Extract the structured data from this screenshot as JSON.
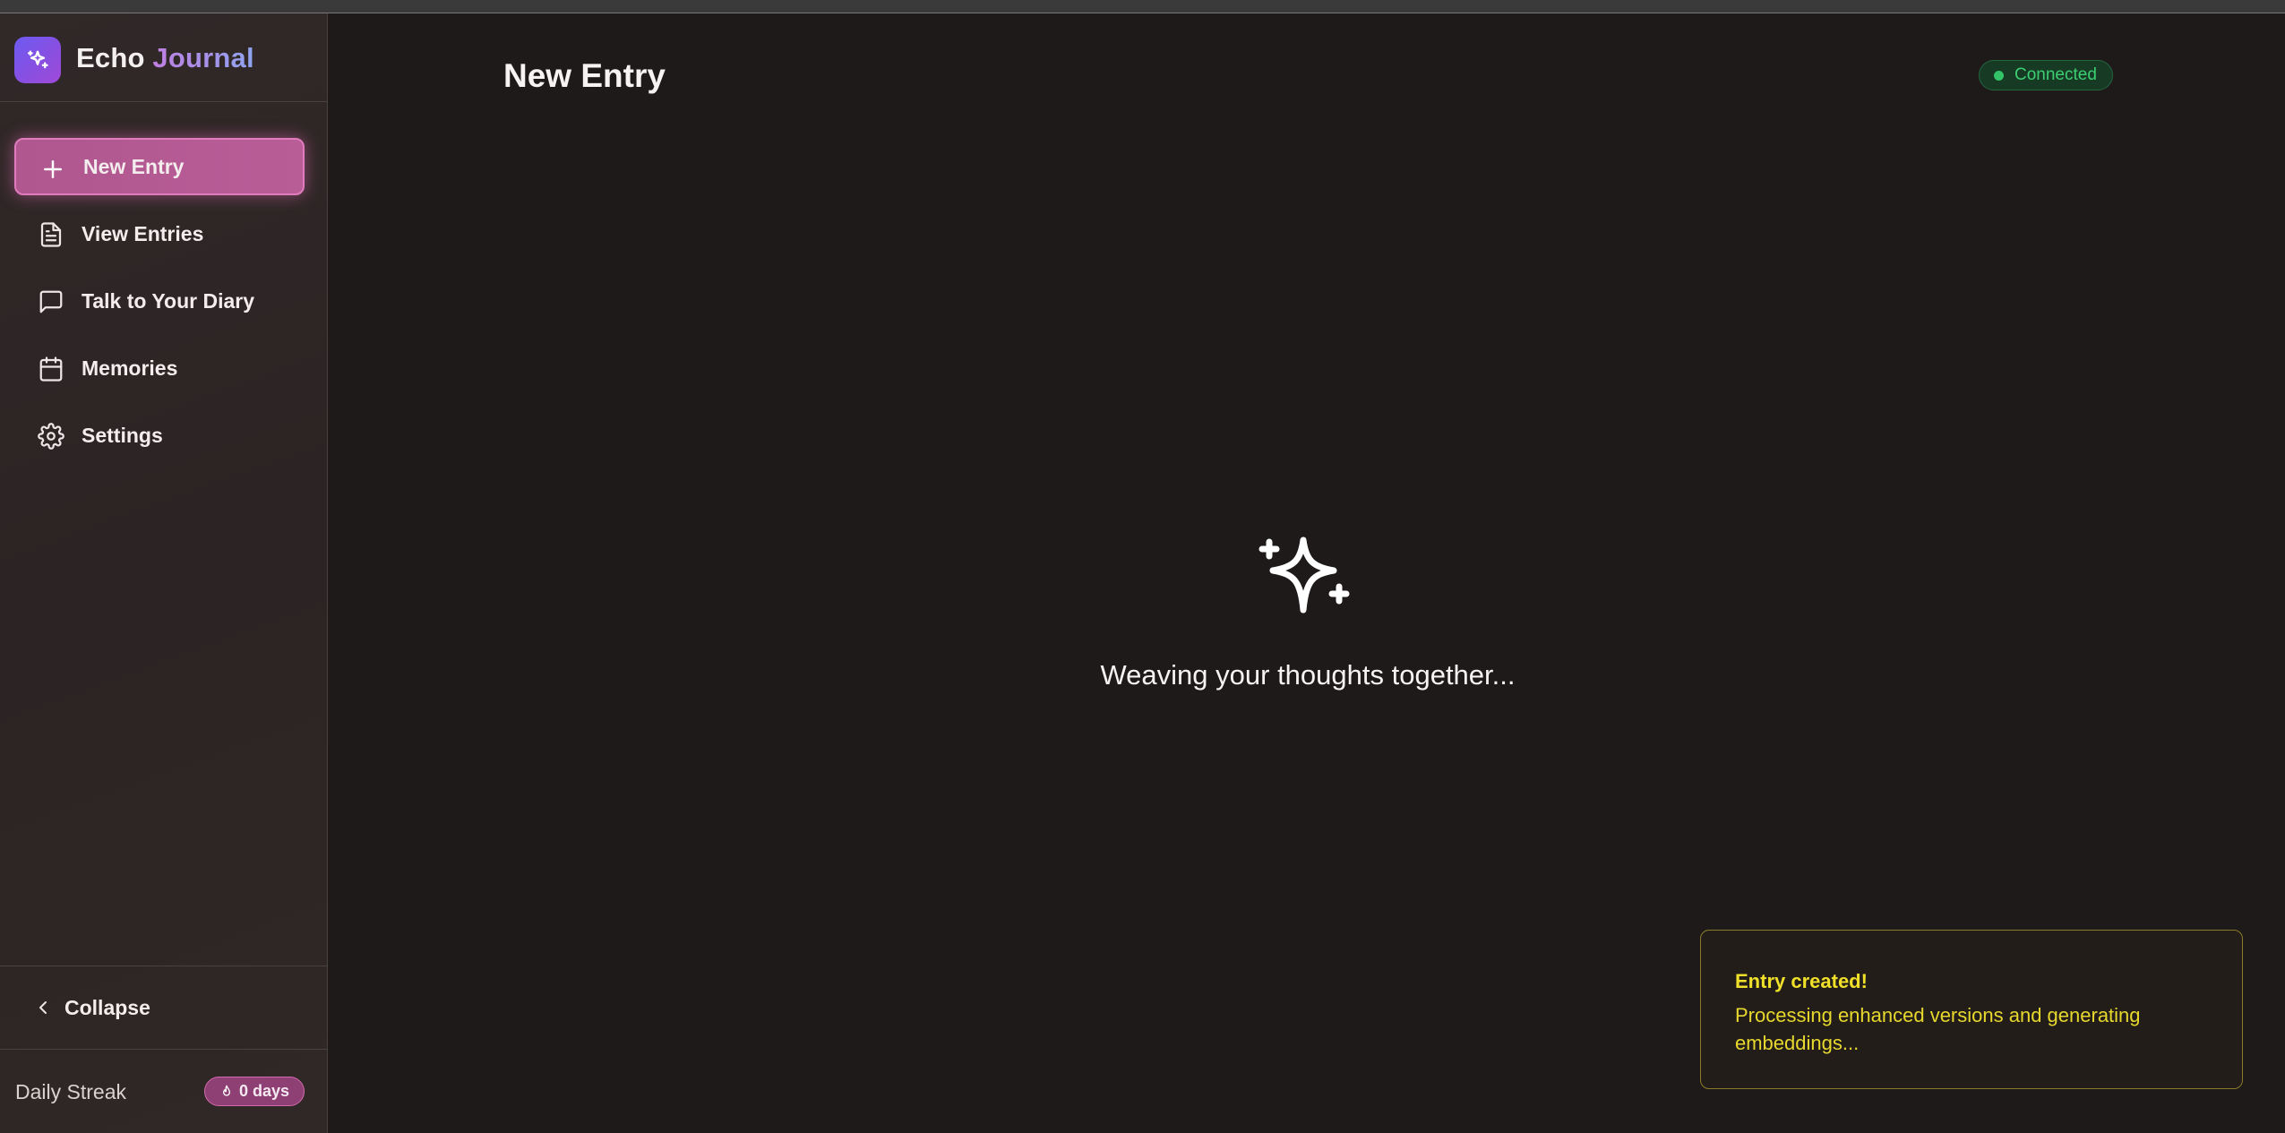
{
  "app": {
    "name_part1": "Echo",
    "name_part2": "Journal"
  },
  "sidebar": {
    "items": [
      {
        "label": "New Entry",
        "icon": "plus-icon",
        "active": true
      },
      {
        "label": "View Entries",
        "icon": "document-icon",
        "active": false
      },
      {
        "label": "Talk to Your Diary",
        "icon": "chat-bubble-icon",
        "active": false
      },
      {
        "label": "Memories",
        "icon": "calendar-icon",
        "active": false
      },
      {
        "label": "Settings",
        "icon": "gear-icon",
        "active": false
      }
    ],
    "collapse_label": "Collapse",
    "streak_label": "Daily Streak",
    "streak_value": "0 days"
  },
  "header": {
    "title": "New Entry",
    "status": "Connected"
  },
  "main": {
    "loading_text": "Weaving your thoughts together..."
  },
  "toast": {
    "title": "Entry created!",
    "message": "Processing enhanced versions and generating embeddings..."
  },
  "colors": {
    "background": "#1f1a1a",
    "accent": "#b95d97",
    "status_green": "#3ccf72",
    "toast_yellow": "#f0e02a"
  }
}
